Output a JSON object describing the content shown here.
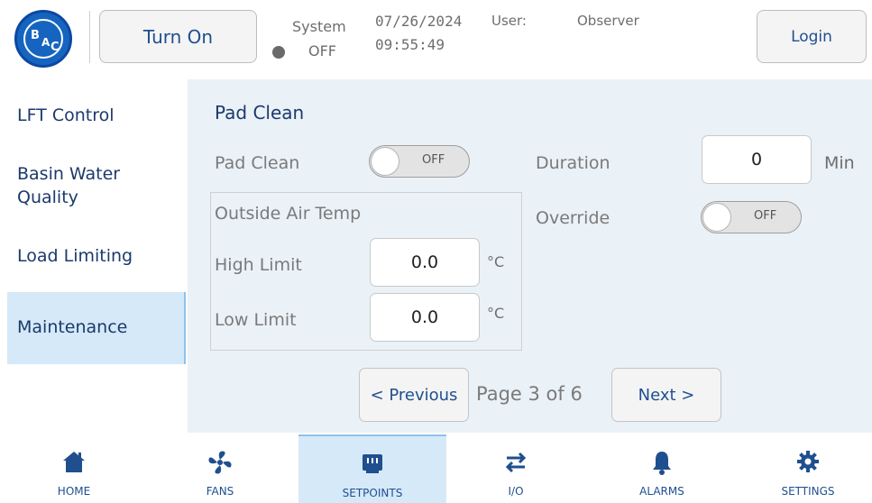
{
  "header": {
    "logo_text": "BAC",
    "turn_on_label": "Turn On",
    "system_label": "System",
    "system_state": "OFF",
    "date": "07/26/2024",
    "time": "09:55:49",
    "user_label": "User:",
    "user_value": "Observer",
    "login_label": "Login",
    "status_dot_color": "#6a6a6a"
  },
  "sidebar": {
    "items": [
      {
        "label": "LFT Control"
      },
      {
        "label": "Basin Water",
        "label2": "Quality"
      },
      {
        "label": "Load Limiting"
      },
      {
        "label": "Maintenance",
        "active": true
      }
    ]
  },
  "main": {
    "section_title": "Pad Clean",
    "pad_clean_label": "Pad Clean",
    "pad_clean_toggle": "OFF",
    "duration_label": "Duration",
    "duration_value": "0",
    "duration_unit": "Min",
    "override_label": "Override",
    "override_toggle": "OFF",
    "oat_group_label": "Outside Air Temp",
    "high_limit_label": "High Limit",
    "high_limit_value": "0.0",
    "high_limit_unit": "°C",
    "low_limit_label": "Low Limit",
    "low_limit_value": "0.0",
    "low_limit_unit": "°C",
    "previous_label": "< Previous",
    "page_indicator": "Page 3 of 6",
    "next_label": "Next >"
  },
  "tabs": [
    {
      "label": "HOME",
      "icon": "home-icon"
    },
    {
      "label": "FANS",
      "icon": "fan-icon"
    },
    {
      "label": "SETPOINTS",
      "icon": "setpoints-icon",
      "active": true
    },
    {
      "label": "I/O",
      "icon": "io-arrows-icon"
    },
    {
      "label": "ALARMS",
      "icon": "bell-icon"
    },
    {
      "label": "SETTINGS",
      "icon": "gear-icon"
    }
  ],
  "colors": {
    "accent": "#1f4f8f",
    "panel_bg": "#eaf1f7",
    "active_bg": "#d6e9f9",
    "logo_blue": "#1565c0"
  }
}
